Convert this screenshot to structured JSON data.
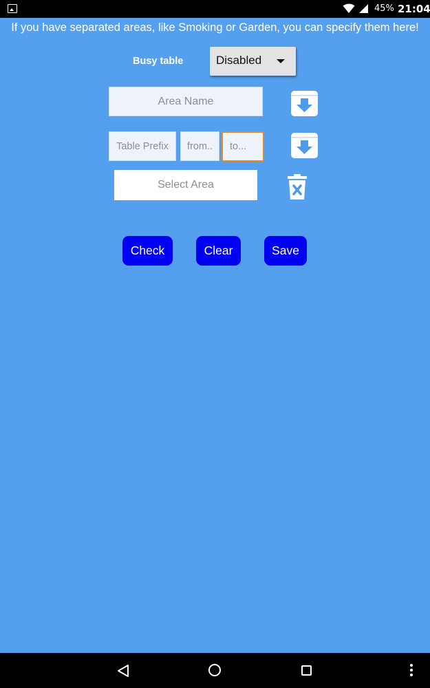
{
  "status_bar": {
    "battery": "45%",
    "time": "21:04",
    "icons": [
      "image-notification-icon",
      "wifi-icon",
      "signal-icon",
      "battery-icon"
    ]
  },
  "intro_text": "If you have separated areas, like Smoking or Garden, you can specify them here!",
  "busy_table": {
    "label": "Busy table",
    "selected": "Disabled"
  },
  "area_name": {
    "placeholder": "Area Name"
  },
  "table_prefix": {
    "placeholder": "Table Prefix"
  },
  "from": {
    "placeholder": "from.."
  },
  "to": {
    "placeholder": "to..."
  },
  "select_area": {
    "placeholder": "Select Area"
  },
  "buttons": {
    "check": "Check",
    "clear": "Clear",
    "save": "Save"
  },
  "colors": {
    "background": "#54a0ee",
    "button": "#0000f2",
    "focus_border": "#e38b2a"
  }
}
